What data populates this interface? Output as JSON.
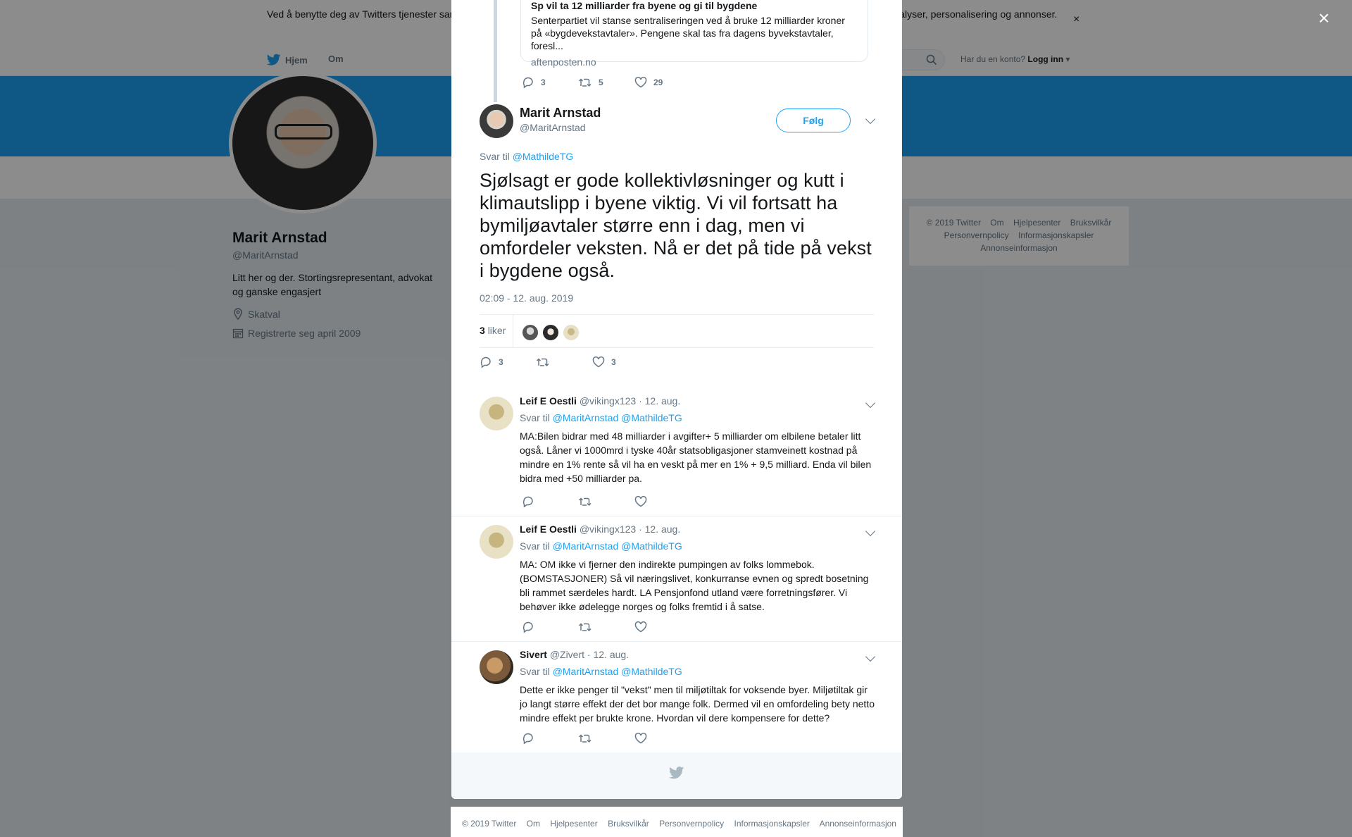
{
  "cookie": {
    "text": "Ved å benytte deg av Twitters tjenester samtykker du i vår bruk av informasjonskapsler. Vi og våre partnere bruker informasjonskapsler til bl.a. analyser, personalisering og annonser.",
    "close": "×"
  },
  "nav": {
    "home": "Hjem",
    "about": "Om",
    "have_account": "Har du en konto?",
    "login": "Logg inn"
  },
  "profile": {
    "name": "Marit Arnstad",
    "handle": "@MaritArnstad",
    "bio": "Litt her og der. Stortingsrepresentant, advokat og ganske engasjert",
    "location": "Skatval",
    "joined": "Registrerte seg april 2009"
  },
  "side_footer": {
    "row1": [
      "© 2019 Twitter",
      "Om",
      "Hjelpesenter",
      "Bruksvilkår"
    ],
    "row2": [
      "Personvernpolicy",
      "Informasjonskapsler"
    ],
    "row3": [
      "Annonseinformasjon"
    ]
  },
  "modal_close": "×",
  "parent_tweet": {
    "card_title": "Sp vil ta 12 milliarder fra byene og gi til bygdene",
    "card_desc": "Senterpartiet vil stanse sentraliseringen ved å bruke 12 milliarder kroner på «bygdevekstavtaler». Pengene skal tas fra dagens byvekstavtaler, foresl...",
    "card_domain": "aftenposten.no",
    "replies": "3",
    "retweets": "5",
    "likes": "29"
  },
  "tweet": {
    "name": "Marit Arnstad",
    "handle": "@MaritArnstad",
    "follow": "Følg",
    "reply_prefix": "Svar til",
    "reply_mention": "@MathildeTG",
    "text": "Sjølsagt er gode kollektivløsninger og kutt i klimautslipp i byene viktig. Vi vil fortsatt ha bymiljøavtaler større enn i dag, men vi omfordeler veksten. Nå er det på tide på vekst i bygdene også.",
    "time": "02:09 - 12. aug. 2019",
    "likes_count": "3",
    "likes_label": "liker",
    "replies": "3",
    "retweets": "",
    "likes": "3"
  },
  "replies": [
    {
      "name": "Leif E Oestli",
      "handle": "@vikingx123",
      "date": "· 12. aug.",
      "reply_prefix": "Svar til",
      "mentions": "@MaritArnstad @MathildeTG",
      "text": "MA:Bilen bidrar med 48 milliarder i avgifter+ 5 milliarder om elbilene betaler litt også. Låner vi 1000mrd i tyske 40år statsobligasjoner stamveinett kostnad på mindre en 1% rente så vil ha en veskt på mer en 1% + 9,5 milliard. Enda vil bilen bidra med +50 milliarder pa."
    },
    {
      "name": "Leif E Oestli",
      "handle": "@vikingx123",
      "date": "· 12. aug.",
      "reply_prefix": "Svar til",
      "mentions": "@MaritArnstad @MathildeTG",
      "text": "MA: OM ikke vi fjerner den indirekte pumpingen av folks lommebok. (BOMSTASJONER) Så vil næringslivet, konkurranse evnen og spredt bosetning bli rammet særdeles hardt. LA Pensjonfond utland være forretningsfører. Vi behøver ikke ødelegge norges og folks fremtid i å satse."
    },
    {
      "name": "Sivert",
      "handle": "@Zivert",
      "date": "· 12. aug.",
      "reply_prefix": "Svar til",
      "mentions": "@MaritArnstad @MathildeTG",
      "text": "Dette er ikke penger til \"vekst\" men til miljøtiltak for voksende byer. Miljøtiltak gir jo langt større effekt der det bor mange folk. Dermed vil en omfordeling bety netto mindre effekt per brukte krone. Hvordan vil dere kompensere for dette?"
    }
  ],
  "bottom_footer": [
    "© 2019 Twitter",
    "Om",
    "Hjelpesenter",
    "Bruksvilkår",
    "Personvernpolicy",
    "Informasjonskapsler",
    "Annonseinformasjon"
  ],
  "colors": {
    "brand": "#1da1f2",
    "muted": "#657786",
    "text": "#14171a"
  },
  "icons": [
    "twitter-bird-icon",
    "search-icon",
    "location-icon",
    "calendar-icon",
    "reply-icon",
    "retweet-icon",
    "like-icon",
    "close-icon",
    "chevron-down-icon"
  ]
}
